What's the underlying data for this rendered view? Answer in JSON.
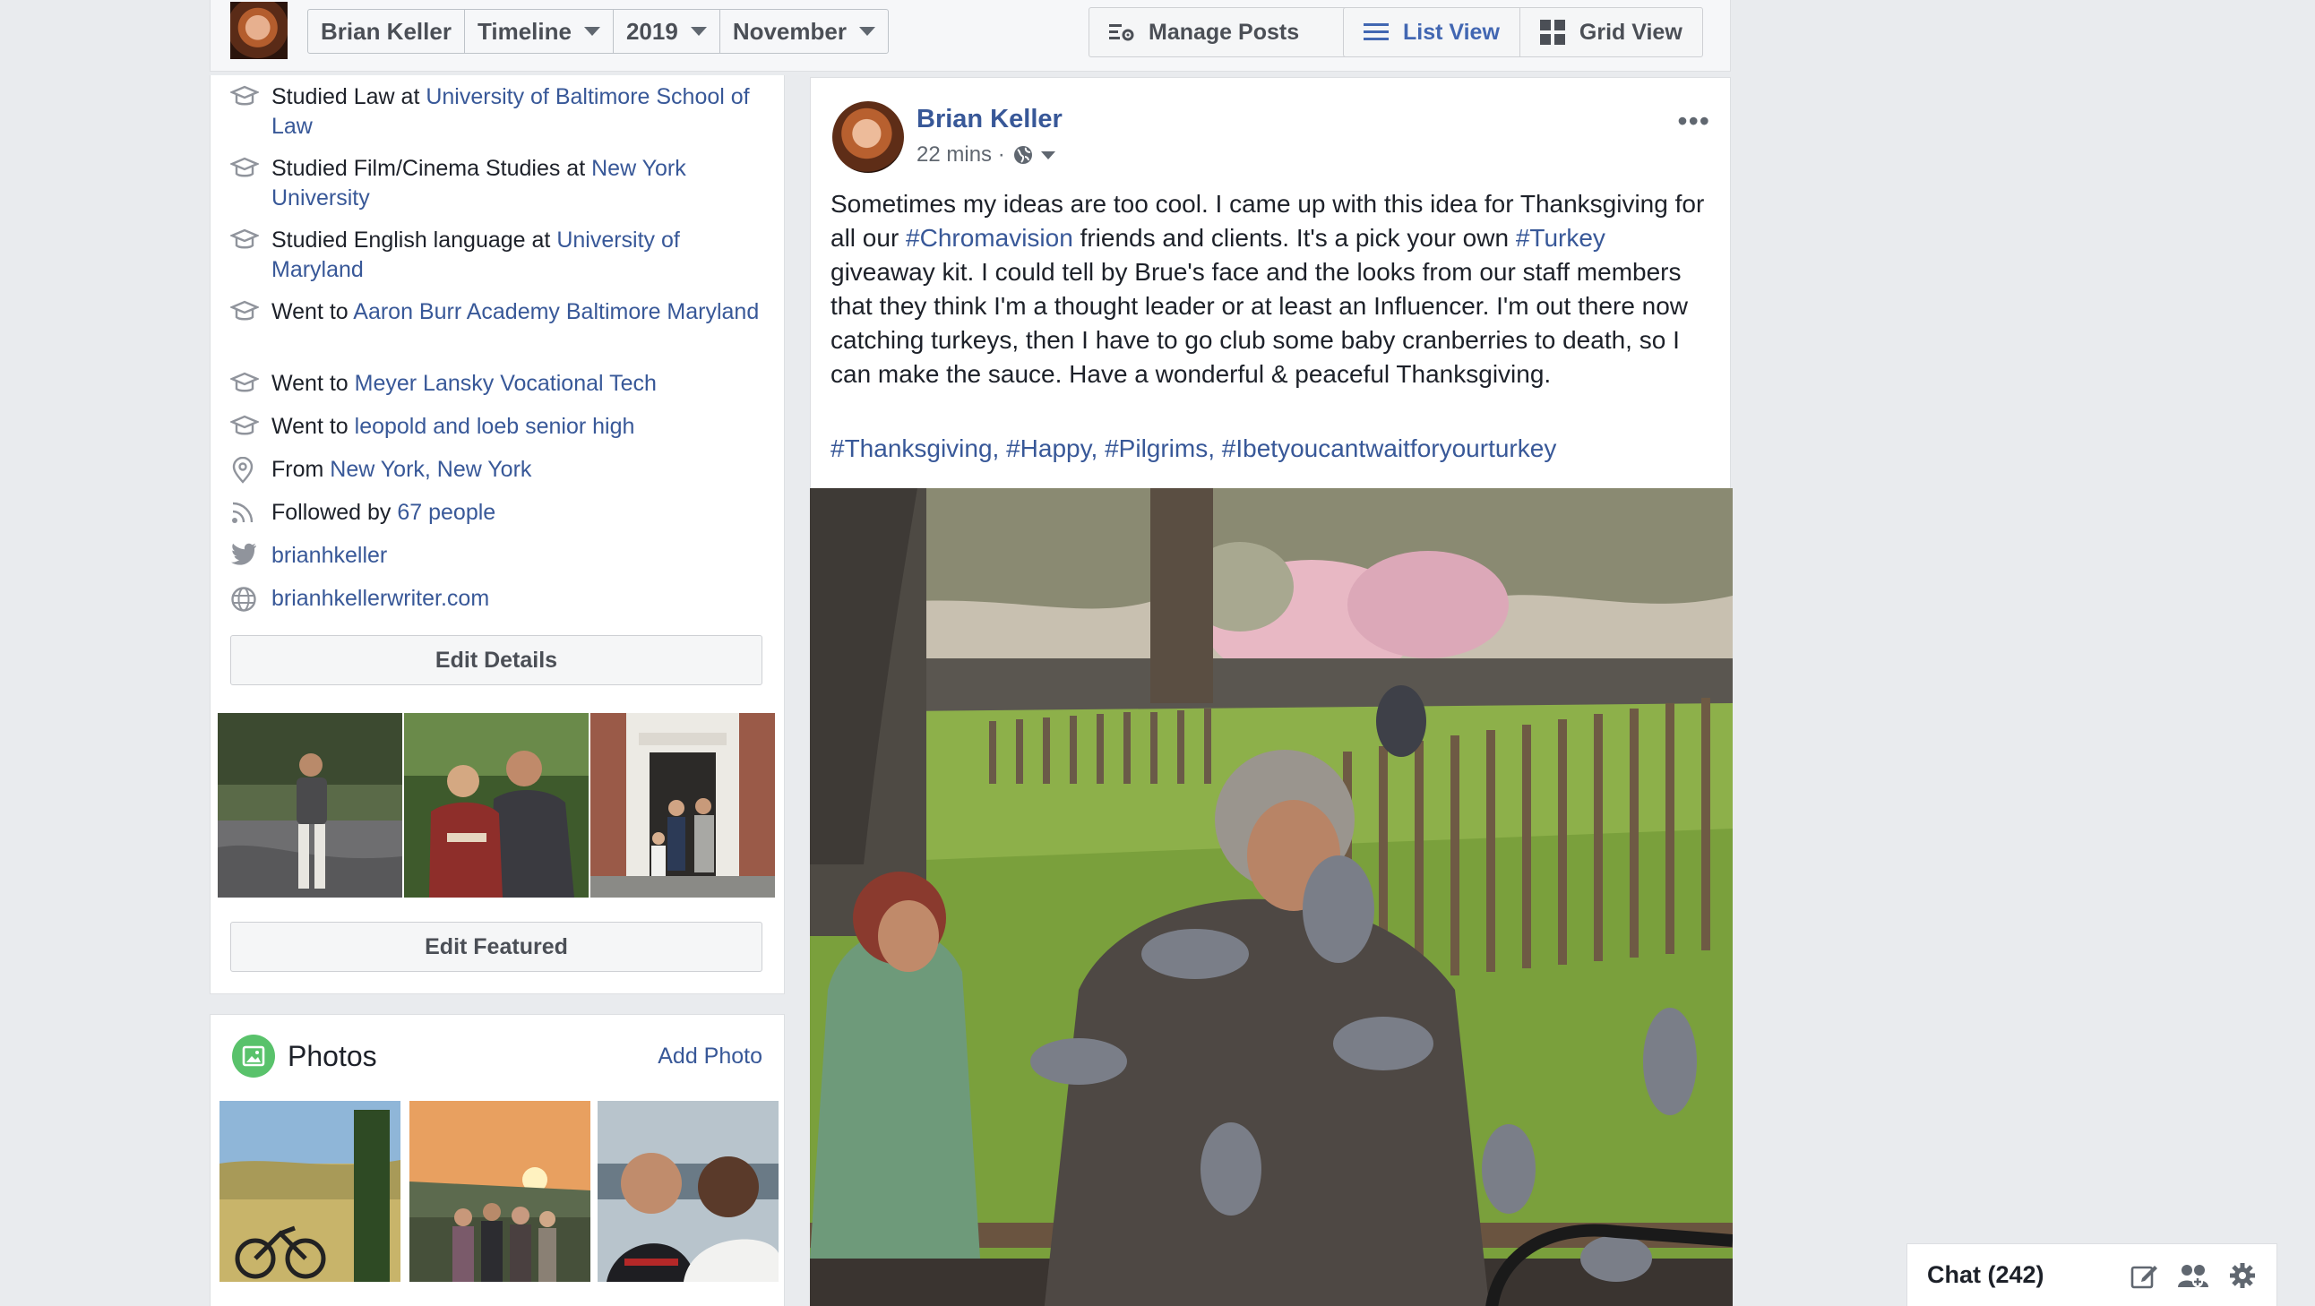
{
  "topbar": {
    "profile_name": "Brian Keller",
    "section": "Timeline",
    "year": "2019",
    "month": "November",
    "manage_posts": "Manage Posts",
    "list_view": "List View",
    "grid_view": "Grid View"
  },
  "intro": {
    "items": [
      {
        "prefix": "Studied Law at ",
        "link": "University of Baltimore School of Law",
        "icon": "education-icon"
      },
      {
        "prefix": "Studied Film/Cinema Studies at ",
        "link": "New York University",
        "icon": "education-icon"
      },
      {
        "prefix": "Studied English language at ",
        "link": "University of Maryland",
        "icon": "education-icon"
      },
      {
        "prefix": "Went to ",
        "link": "Aaron Burr Academy Baltimore Maryland",
        "icon": "education-icon"
      },
      {
        "prefix": "Went to ",
        "link": "Meyer Lansky Vocational Tech",
        "icon": "education-icon"
      },
      {
        "prefix": "Went to ",
        "link": "leopold and loeb senior high",
        "icon": "education-icon"
      },
      {
        "prefix": "From ",
        "link": "New York, New York",
        "icon": "location-pin-icon"
      },
      {
        "prefix": "Followed by ",
        "link": "67 people",
        "icon": "rss-icon"
      },
      {
        "prefix": "",
        "link": "brianhkeller",
        "icon": "twitter-icon"
      },
      {
        "prefix": "",
        "link": "brianhkellerwriter.com",
        "icon": "globe-icon"
      }
    ],
    "edit_details": "Edit Details",
    "edit_featured": "Edit Featured"
  },
  "photos": {
    "title": "Photos",
    "add_photo": "Add Photo"
  },
  "post": {
    "author": "Brian Keller",
    "time": "22 mins ·",
    "text_1": "Sometimes my ideas are too cool. I came up with this idea for Thanksgiving for all our ",
    "hashtag_1": "#Chromavision",
    "text_2": " friends and clients. It's a pick your own ",
    "hashtag_2": "#Turkey",
    "text_3": " giveaway kit. I could tell by Brue's face and the looks from our staff members that they think I'm a thought leader or at least an Influencer. I'm out there now catching turkeys, then I have to go club some baby cranberries to death, so I can make the sauce. Have a wonderful & peaceful Thanksgiving.",
    "tags": "#Thanksgiving, #Happy, #Pilgrims, #Ibetyoucantwaitforyourturkey",
    "more": "•••"
  },
  "chat": {
    "label": "Chat (242)"
  }
}
